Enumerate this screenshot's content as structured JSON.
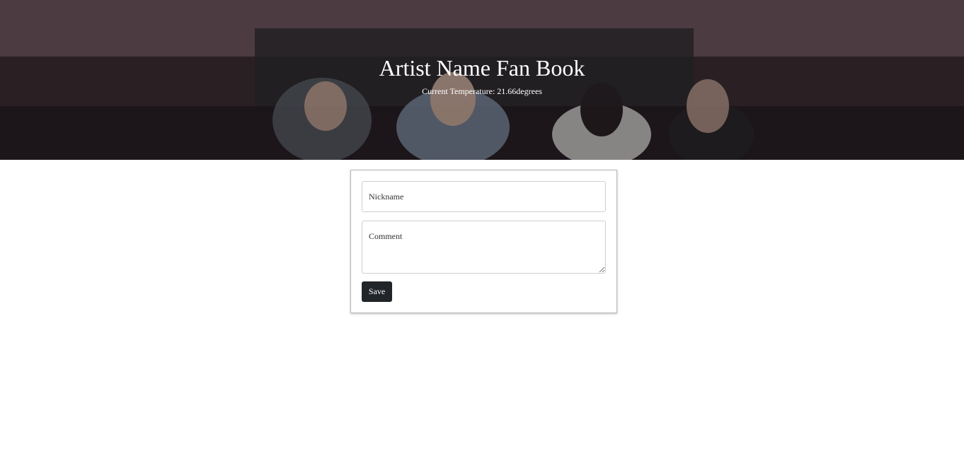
{
  "header": {
    "title": "Artist Name Fan Book",
    "subtitle": "Current Temperature: 21.66degrees"
  },
  "form": {
    "nickname_placeholder": "Nickname",
    "comment_placeholder": "Comment",
    "save_label": "Save"
  },
  "colors": {
    "button_bg": "#212529",
    "card_border": "#b8b8b8",
    "hero_text": "#ffffff"
  }
}
